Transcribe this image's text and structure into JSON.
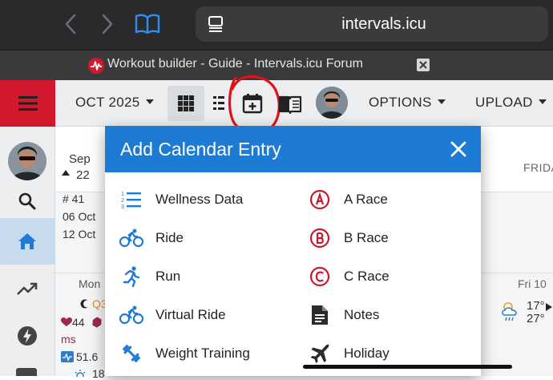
{
  "browser": {
    "url": "intervals.icu",
    "tab_title": "Workout builder - Guide - Intervals.icu Forum"
  },
  "toolbar": {
    "month": "OCT 2025",
    "options": "OPTIONS",
    "upload": "UPLOAD"
  },
  "calendar": {
    "header": {
      "month": "Sep",
      "day": "22",
      "right_day": "FRIDA"
    },
    "week": {
      "number": "# 41",
      "start": "06 Oct",
      "end": "12 Oct"
    },
    "row": {
      "monday": "Mon",
      "q_label": "Q3",
      "hr_value": "44",
      "unit": "ms",
      "hrv_value": "51.6",
      "partial_value": "18",
      "friday": "Fri 10",
      "temp_high": "17°",
      "temp_low": "27°"
    }
  },
  "modal": {
    "title": "Add Calendar Entry",
    "left_items": [
      {
        "label": "Wellness Data",
        "icon": "numbered-list-icon"
      },
      {
        "label": "Ride",
        "icon": "bike-icon"
      },
      {
        "label": "Run",
        "icon": "runner-icon"
      },
      {
        "label": "Virtual Ride",
        "icon": "bike-icon"
      },
      {
        "label": "Weight Training",
        "icon": "dumbbell-icon"
      }
    ],
    "right_items": [
      {
        "label": "A Race",
        "icon": "circle-a-icon",
        "letter": "A"
      },
      {
        "label": "B Race",
        "icon": "circle-b-icon",
        "letter": "B"
      },
      {
        "label": "C Race",
        "icon": "circle-c-icon",
        "letter": "C"
      },
      {
        "label": "Notes",
        "icon": "note-icon"
      },
      {
        "label": "Holiday",
        "icon": "airplane-icon"
      }
    ]
  },
  "colors": {
    "brand_red": "#d2182d",
    "modal_blue": "#1e7bd4",
    "icon_blue": "#1e7bd4",
    "race_red": "#c8192e",
    "annotation_red": "#e3101c"
  }
}
